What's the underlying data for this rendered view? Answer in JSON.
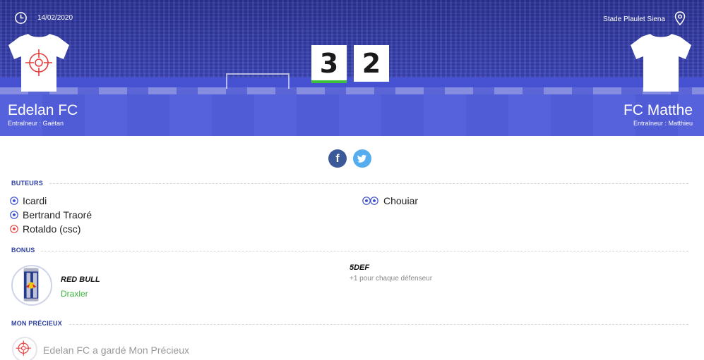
{
  "match": {
    "date": "14/02/2020",
    "venue": "Stade Plaulet Siena",
    "home": {
      "name": "Edelan FC",
      "coach": "Entraîneur : Gaëtan",
      "score": "3"
    },
    "away": {
      "name": "FC Matthe",
      "coach": "Entraîneur : Matthieu",
      "score": "2"
    }
  },
  "social": {
    "facebook_glyph": "f"
  },
  "sections": {
    "scorers_title": "BUTEURS",
    "bonus_title": "BONUS",
    "precious_title": "MON PRÉCIEUX"
  },
  "scorers": {
    "home": [
      {
        "name": "Icardi",
        "icon": "ball-icon"
      },
      {
        "name": "Bertrand Traoré",
        "icon": "ball-icon"
      },
      {
        "name": "Rotaldo (csc)",
        "icon": "own-goal-ball-icon"
      }
    ],
    "away": [
      {
        "name": "Chouiar",
        "icon": "double-ball-icon"
      }
    ]
  },
  "bonus": {
    "home": {
      "name": "RED BULL",
      "player": "Draxler"
    },
    "away": {
      "name": "5DEF",
      "description": "+1 pour chaque défenseur"
    }
  },
  "precious": {
    "text": "Edelan FC a gardé Mon Précieux"
  },
  "colors": {
    "hero": "#4350cf",
    "accent": "#2c3e9f",
    "goal_ball": "#3b4fc8",
    "own_goal_ball": "#e04848",
    "success": "#3cc13c"
  }
}
